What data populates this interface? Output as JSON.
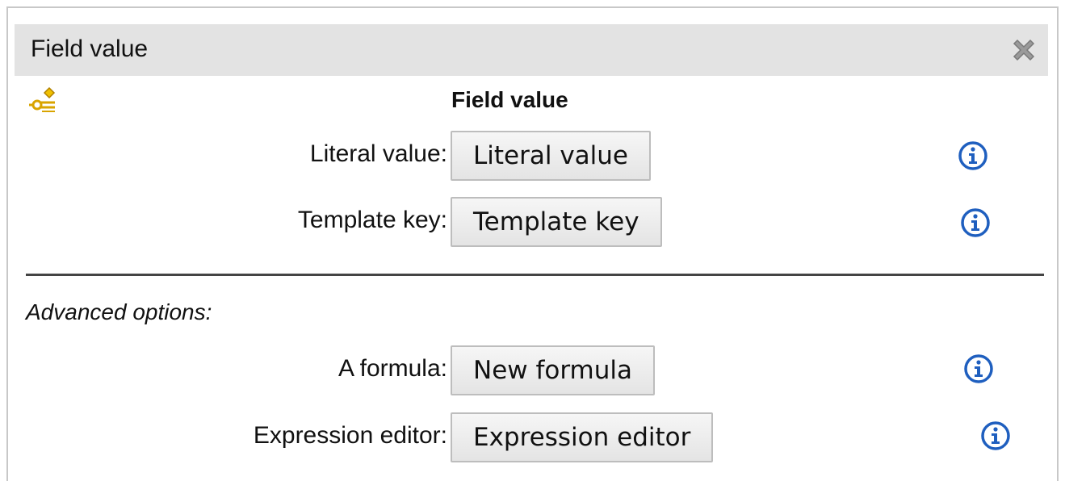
{
  "dialog": {
    "title": "Field value",
    "close_icon": "close-x-icon"
  },
  "section": {
    "icon": "field-value-icon",
    "heading": "Field value"
  },
  "rows": [
    {
      "label": "Literal value:",
      "button": "Literal value",
      "info_icon": "info-icon"
    },
    {
      "label": "Template key:",
      "button": "Template key",
      "info_icon": "info-icon"
    }
  ],
  "advanced": {
    "heading": "Advanced options:",
    "rows": [
      {
        "label": "A formula:",
        "button": "New formula",
        "info_icon": "info-icon"
      },
      {
        "label": "Expression editor:",
        "button": "Expression editor",
        "info_icon": "info-icon"
      }
    ]
  },
  "colors": {
    "titlebar_bg": "#e3e3e3",
    "info_blue": "#1f5fbf",
    "icon_gold": "#d9a400"
  }
}
